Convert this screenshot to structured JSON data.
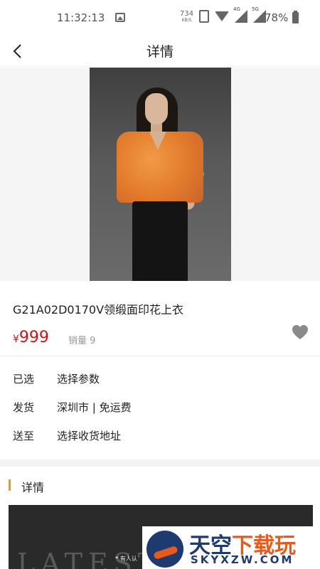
{
  "status_bar": {
    "time": "11:32:13",
    "net_speed_value": "734",
    "net_speed_unit": "KB/S",
    "signal1_label": "4G",
    "signal2_label": "5G",
    "battery": "78%"
  },
  "nav": {
    "title": "详情"
  },
  "product": {
    "name": "G21A02D0170V领缎面印花上衣",
    "currency": "¥",
    "price": "999",
    "sales": "销量 9"
  },
  "info_rows": [
    {
      "key": "已选",
      "value": "选择参数"
    },
    {
      "key": "发货",
      "value": "深圳市 | 免运费"
    },
    {
      "key": "送至",
      "value": "选择收货地址"
    }
  ],
  "section": {
    "title": "详情"
  },
  "detail_image": {
    "text": "LATEST",
    "caption": "❝ 有人认"
  },
  "watermark": {
    "title_part1": "天空",
    "title_part2": "下载玩",
    "domain": "SKYXZW.COM"
  },
  "colors": {
    "price": "#c4161c",
    "accent_bar": "#c9a257",
    "watermark_blue": "#1e3a6e",
    "watermark_orange": "#e85a1c"
  }
}
